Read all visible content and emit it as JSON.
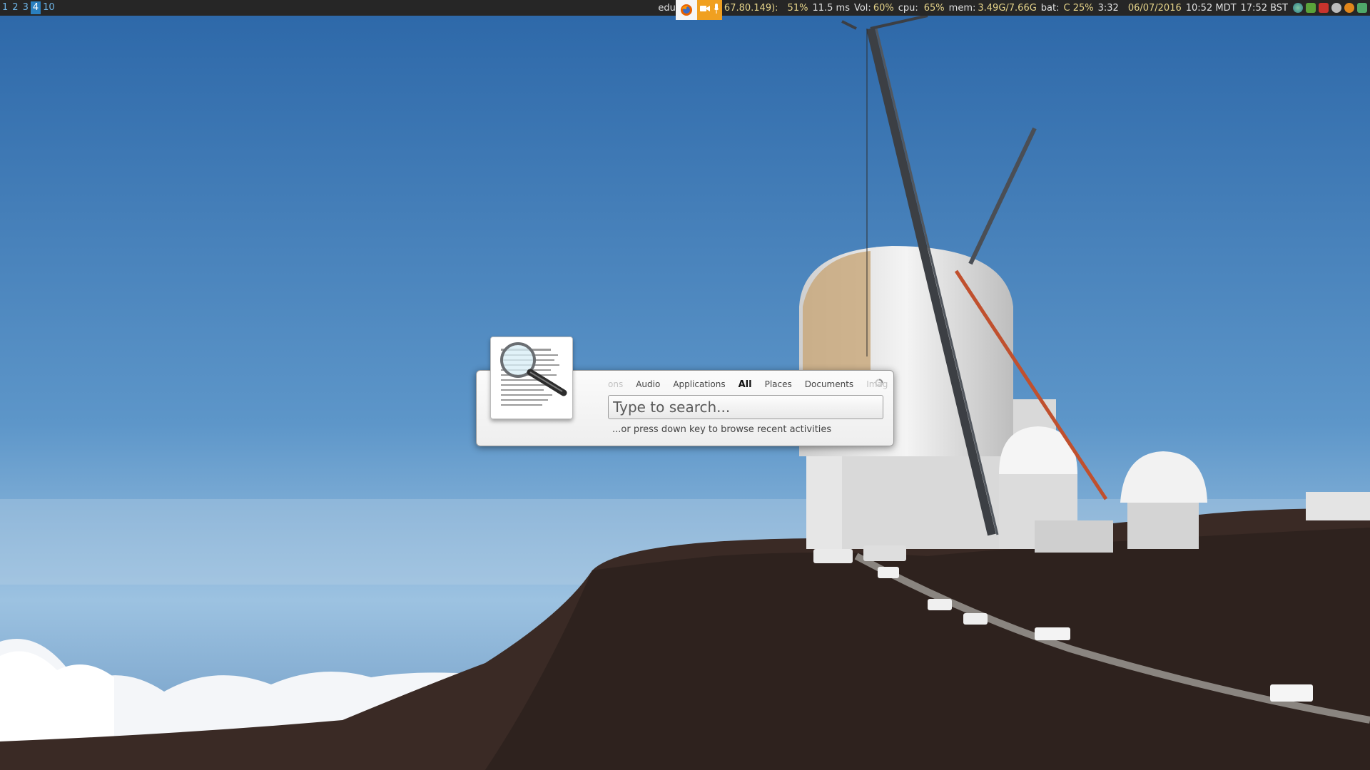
{
  "workspaces": [
    {
      "label": "1",
      "active": false
    },
    {
      "label": "2",
      "active": false
    },
    {
      "label": "3",
      "active": false
    },
    {
      "label": "4",
      "active": true
    },
    {
      "label": "10",
      "active": false
    }
  ],
  "status": {
    "net_prefix": "edu",
    "ip": "67.80.149):",
    "wifi": "51%",
    "ping": "11.5 ms",
    "vol_label": "Vol:",
    "vol_value": "60%",
    "cpu_label": "cpu:",
    "cpu_value": "65%",
    "mem_label": "mem:",
    "mem_value": "3.49G/7.66G",
    "bat_label": "bat:",
    "bat_value": "C 25%",
    "bat_time": "3:32",
    "date": "06/07/2016",
    "time_local": "10:52 MDT",
    "time_bst": "17:52 BST"
  },
  "tray_icons": [
    "globe-icon",
    "shield-icon",
    "pdf-icon",
    "sync-icon",
    "warning-icon",
    "network-icon"
  ],
  "search": {
    "tabs": [
      {
        "label": "ons",
        "state": "faded"
      },
      {
        "label": "Audio",
        "state": "normal"
      },
      {
        "label": "Applications",
        "state": "normal"
      },
      {
        "label": "All",
        "state": "selected"
      },
      {
        "label": "Places",
        "state": "normal"
      },
      {
        "label": "Documents",
        "state": "normal"
      },
      {
        "label": "Imag",
        "state": "faded"
      }
    ],
    "placeholder": "Type to search...",
    "hint": "...or press down key to browse recent activities"
  },
  "colors": {
    "bar_bg": "#262626",
    "workspace_active": "#2a7fbf",
    "value_yellow": "#e6d48a",
    "sky_top": "#2c67a8",
    "sky_bottom": "#9cc4e4"
  }
}
